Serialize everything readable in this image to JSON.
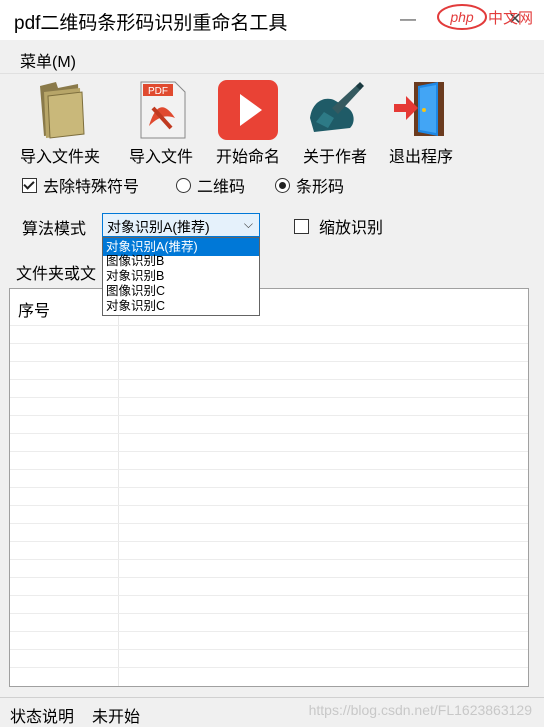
{
  "window": {
    "title": "pdf二维码条形码识别重命名工具"
  },
  "watermark_logo": {
    "text_php": "php",
    "text_cn": "中文网"
  },
  "menu": {
    "label": "菜单(M)"
  },
  "toolbar": {
    "buttons": [
      {
        "label": "导入文件夹",
        "icon": "folder-icon"
      },
      {
        "label": "导入文件",
        "icon": "pdf-file-icon"
      },
      {
        "label": "开始命名",
        "icon": "play-icon"
      },
      {
        "label": "关于作者",
        "icon": "author-icon"
      },
      {
        "label": "退出程序",
        "icon": "exit-door-icon"
      }
    ]
  },
  "options": {
    "remove_special_label": "去除特殊符号",
    "remove_special_checked": true,
    "qr_label": "二维码",
    "barcode_label": "条形码",
    "selected_mode": "barcode"
  },
  "algorithm": {
    "label": "算法模式",
    "selected": "对象识别A(推荐)",
    "options": [
      "对象识别A(推荐)",
      "图像识别B",
      "对象识别B",
      "图像识别C",
      "对象识别C"
    ]
  },
  "zoom": {
    "label": "缩放识别",
    "checked": false
  },
  "folder": {
    "label": "文件夹或文"
  },
  "grid": {
    "header_index": "序号"
  },
  "status": {
    "label": "状态说明",
    "value": "未开始"
  },
  "watermark": "https://blog.csdn.net/FL1623863129"
}
